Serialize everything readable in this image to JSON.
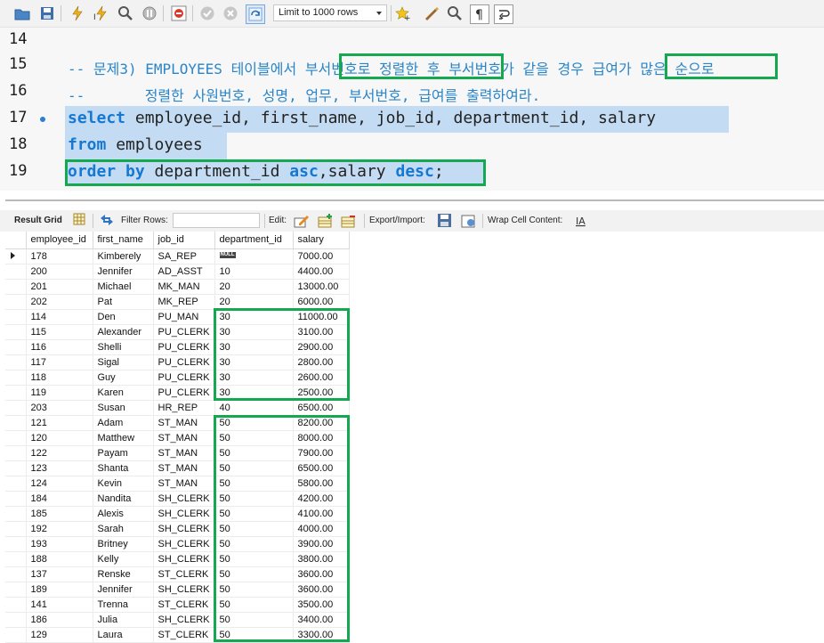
{
  "toolbar": {
    "limit_label": "Limit to 1000 rows",
    "icons": [
      "open-folder-icon",
      "save-icon",
      "execute-icon",
      "execute-current-icon",
      "explain-icon",
      "stop-icon",
      "toggle-errors-icon",
      "commit-icon",
      "rollback-icon",
      "autocommit-icon",
      "beautify-icon",
      "find-icon",
      "invisible-chars-icon",
      "wrap-icon"
    ]
  },
  "editor": {
    "lines": [
      {
        "n": "14"
      },
      {
        "n": "15",
        "prefix": "-- 문제3) EMPLOYEES 테이블에서 ",
        "h1": "부서번호로 정렬한 후",
        "mid": " 부서번호가 같을 경우 ",
        "h2": "급여가 많은 순",
        "suffix": "으로"
      },
      {
        "n": "16",
        "text": "--       정렬한 사원번호, 성명, 업무, 부서번호, 급여를 출력하여라."
      },
      {
        "n": "17",
        "kw": "select",
        "rest": " employee_id, first_name, job_id, department_id, salary"
      },
      {
        "n": "18",
        "kw": "from",
        "rest": " employees"
      },
      {
        "n": "19",
        "kw": "order by",
        "a": " department_id ",
        "kw2": "asc",
        "b": ",salary ",
        "kw3": "desc",
        "c": ";"
      }
    ]
  },
  "result_toolbar": {
    "result_grid": "Result Grid",
    "filter_rows": "Filter Rows:",
    "edit": "Edit:",
    "export_import": "Export/Import:",
    "wrap_cell": "Wrap Cell Content:"
  },
  "grid": {
    "columns": [
      "employee_id",
      "first_name",
      "job_id",
      "department_id",
      "salary"
    ],
    "null_label": "NULL",
    "rows": [
      [
        "178",
        "Kimberely",
        "SA_REP",
        null,
        "7000.00"
      ],
      [
        "200",
        "Jennifer",
        "AD_ASST",
        "10",
        "4400.00"
      ],
      [
        "201",
        "Michael",
        "MK_MAN",
        "20",
        "13000.00"
      ],
      [
        "202",
        "Pat",
        "MK_REP",
        "20",
        "6000.00"
      ],
      [
        "114",
        "Den",
        "PU_MAN",
        "30",
        "11000.00"
      ],
      [
        "115",
        "Alexander",
        "PU_CLERK",
        "30",
        "3100.00"
      ],
      [
        "116",
        "Shelli",
        "PU_CLERK",
        "30",
        "2900.00"
      ],
      [
        "117",
        "Sigal",
        "PU_CLERK",
        "30",
        "2800.00"
      ],
      [
        "118",
        "Guy",
        "PU_CLERK",
        "30",
        "2600.00"
      ],
      [
        "119",
        "Karen",
        "PU_CLERK",
        "30",
        "2500.00"
      ],
      [
        "203",
        "Susan",
        "HR_REP",
        "40",
        "6500.00"
      ],
      [
        "121",
        "Adam",
        "ST_MAN",
        "50",
        "8200.00"
      ],
      [
        "120",
        "Matthew",
        "ST_MAN",
        "50",
        "8000.00"
      ],
      [
        "122",
        "Payam",
        "ST_MAN",
        "50",
        "7900.00"
      ],
      [
        "123",
        "Shanta",
        "ST_MAN",
        "50",
        "6500.00"
      ],
      [
        "124",
        "Kevin",
        "ST_MAN",
        "50",
        "5800.00"
      ],
      [
        "184",
        "Nandita",
        "SH_CLERK",
        "50",
        "4200.00"
      ],
      [
        "185",
        "Alexis",
        "SH_CLERK",
        "50",
        "4100.00"
      ],
      [
        "192",
        "Sarah",
        "SH_CLERK",
        "50",
        "4000.00"
      ],
      [
        "193",
        "Britney",
        "SH_CLERK",
        "50",
        "3900.00"
      ],
      [
        "188",
        "Kelly",
        "SH_CLERK",
        "50",
        "3800.00"
      ],
      [
        "137",
        "Renske",
        "ST_CLERK",
        "50",
        "3600.00"
      ],
      [
        "189",
        "Jennifer",
        "SH_CLERK",
        "50",
        "3600.00"
      ],
      [
        "141",
        "Trenna",
        "ST_CLERK",
        "50",
        "3500.00"
      ],
      [
        "186",
        "Julia",
        "SH_CLERK",
        "50",
        "3400.00"
      ],
      [
        "129",
        "Laura",
        "ST_CLERK",
        "50",
        "3300.00"
      ]
    ]
  }
}
